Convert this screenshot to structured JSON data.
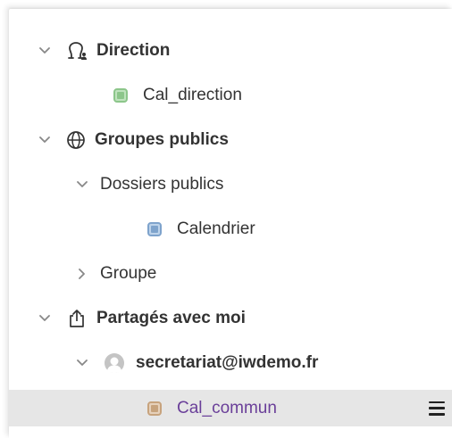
{
  "tree": {
    "items": [
      {
        "label": "Direction",
        "icon": "group-person-icon",
        "expanded": true
      },
      {
        "label": "Cal_direction",
        "icon": "calendar-green-icon",
        "color": "#8cc68a"
      },
      {
        "label": "Groupes publics",
        "icon": "globe-icon",
        "expanded": true
      },
      {
        "label": "Dossiers publics",
        "icon": "chevron-down-icon",
        "expanded": true
      },
      {
        "label": "Calendrier",
        "icon": "calendar-blue-icon",
        "color": "#7ea3cc"
      },
      {
        "label": "Groupe",
        "icon": "chevron-right-icon",
        "expanded": false
      },
      {
        "label": "Partagés avec moi",
        "icon": "share-icon",
        "expanded": true
      },
      {
        "label": "secretariat@iwdemo.fr",
        "icon": "avatar-icon",
        "expanded": true
      },
      {
        "label": "Cal_commun",
        "icon": "calendar-tan-icon",
        "color": "#c7a37d",
        "selected": true
      }
    ]
  },
  "colors": {
    "selected_bg": "#e6e6e6",
    "selected_text": "#6a3f99",
    "text": "#333333",
    "chevron": "#888888"
  }
}
